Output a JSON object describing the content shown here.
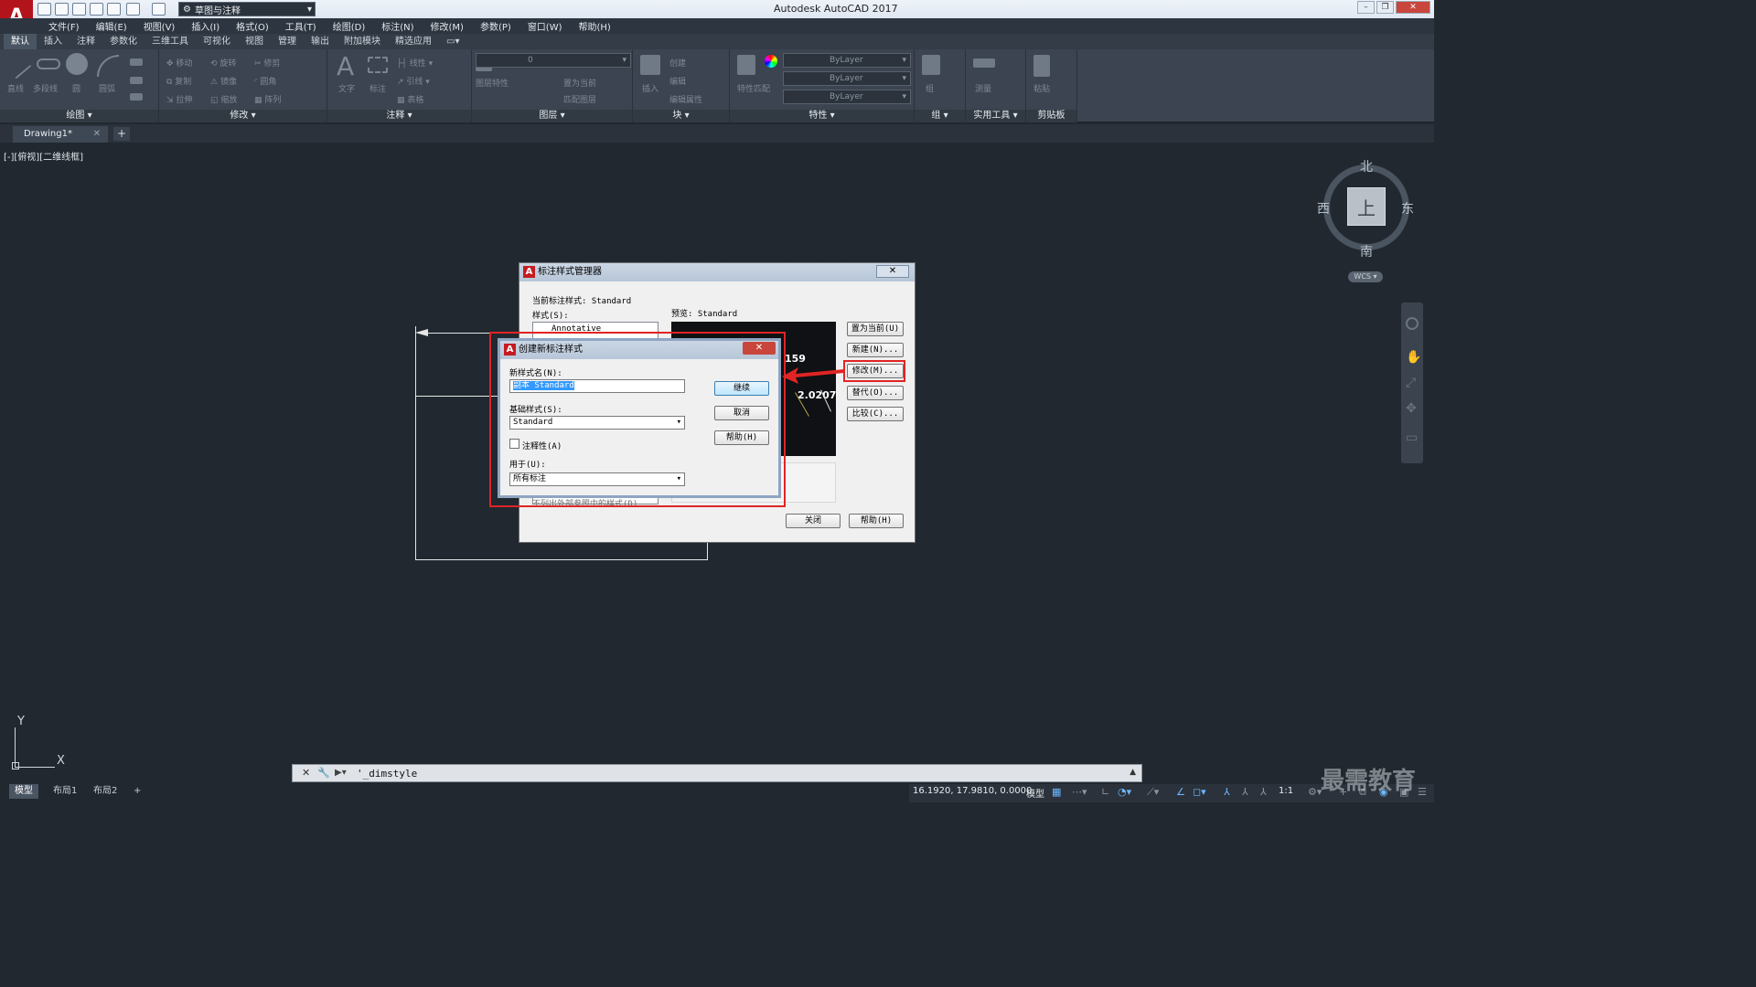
{
  "app": {
    "title": "Autodesk AutoCAD 2017",
    "logo_letter": "A",
    "workspace": "草图与注释"
  },
  "menu": [
    "文件(F)",
    "编辑(E)",
    "视图(V)",
    "插入(I)",
    "格式(O)",
    "工具(T)",
    "绘图(D)",
    "标注(N)",
    "修改(M)",
    "参数(P)",
    "窗口(W)",
    "帮助(H)"
  ],
  "ribbon_tabs": [
    "默认",
    "插入",
    "注释",
    "参数化",
    "三维工具",
    "可视化",
    "视图",
    "管理",
    "输出",
    "附加模块",
    "精选应用"
  ],
  "ribbon": {
    "draw": {
      "label": "绘图",
      "tools": [
        "直线",
        "多段线",
        "圆",
        "圆弧"
      ]
    },
    "modify": {
      "label": "修改",
      "tools": [
        "移动",
        "旋转",
        "修剪",
        "复制",
        "镜像",
        "圆角",
        "拉伸",
        "缩放",
        "阵列"
      ]
    },
    "annotation": {
      "label": "注释",
      "tools": [
        "文字",
        "标注",
        "线性",
        "引线",
        "表格"
      ]
    },
    "layers": {
      "label": "图层",
      "layer_name": "0",
      "tools": [
        "图层特性",
        "置为当前",
        "匹配图层"
      ]
    },
    "block": {
      "label": "块",
      "tools": [
        "插入",
        "创建",
        "编辑",
        "编辑属性"
      ]
    },
    "properties": {
      "label": "特性",
      "color": "ByLayer",
      "linetype": "ByLayer",
      "lineweight": "ByLayer",
      "tools": [
        "特性匹配"
      ]
    },
    "groups": {
      "label": "组",
      "tools": [
        "组"
      ]
    },
    "utilities": {
      "label": "实用工具",
      "tools": [
        "测量"
      ]
    },
    "clipboard": {
      "label": "剪贴板",
      "tools": [
        "粘贴"
      ]
    }
  },
  "document_tab": "Drawing1*",
  "viewport_label": "[-][俯视][二维线框]",
  "viewcube": {
    "north": "北",
    "south": "南",
    "east": "东",
    "west": "西",
    "face": "上",
    "wcs": "WCS"
  },
  "ucs": {
    "x": "X",
    "y": "Y"
  },
  "dimstyle_manager": {
    "title": "标注样式管理器",
    "current_style_label": "当前标注样式: Standard",
    "styles_label": "样式(S):",
    "styles": [
      "Annotative"
    ],
    "preview_label": "预览: Standard",
    "preview_values": [
      "159",
      "2.0207"
    ],
    "list_filter": "不列出外部参照中的样式(D)",
    "buttons": {
      "set_current": "置为当前(U)",
      "new": "新建(N)...",
      "modify": "修改(M)...",
      "override": "替代(O)...",
      "compare": "比较(C)...",
      "close": "关闭",
      "help": "帮助(H)"
    }
  },
  "new_style_dialog": {
    "title": "创建新标注样式",
    "name_label": "新样式名(N):",
    "name_value": "副本 Standard",
    "base_label": "基础样式(S):",
    "base_value": "Standard",
    "annotative_label": "注释性(A)",
    "use_for_label": "用于(U):",
    "use_for_value": "所有标注",
    "buttons": {
      "continue": "继续",
      "cancel": "取消",
      "help": "帮助(H)"
    }
  },
  "command_line": {
    "text": "'_dimstyle"
  },
  "layout_tabs": [
    "模型",
    "布局1",
    "布局2"
  ],
  "status": {
    "coords": "16.1920, 17.9810, 0.0000",
    "model": "模型",
    "scale": "1:1"
  },
  "watermark": "最需教育",
  "colors": {
    "accent_red": "#e12424",
    "canvas": "#212830",
    "autocad_red": "#b3131b"
  }
}
